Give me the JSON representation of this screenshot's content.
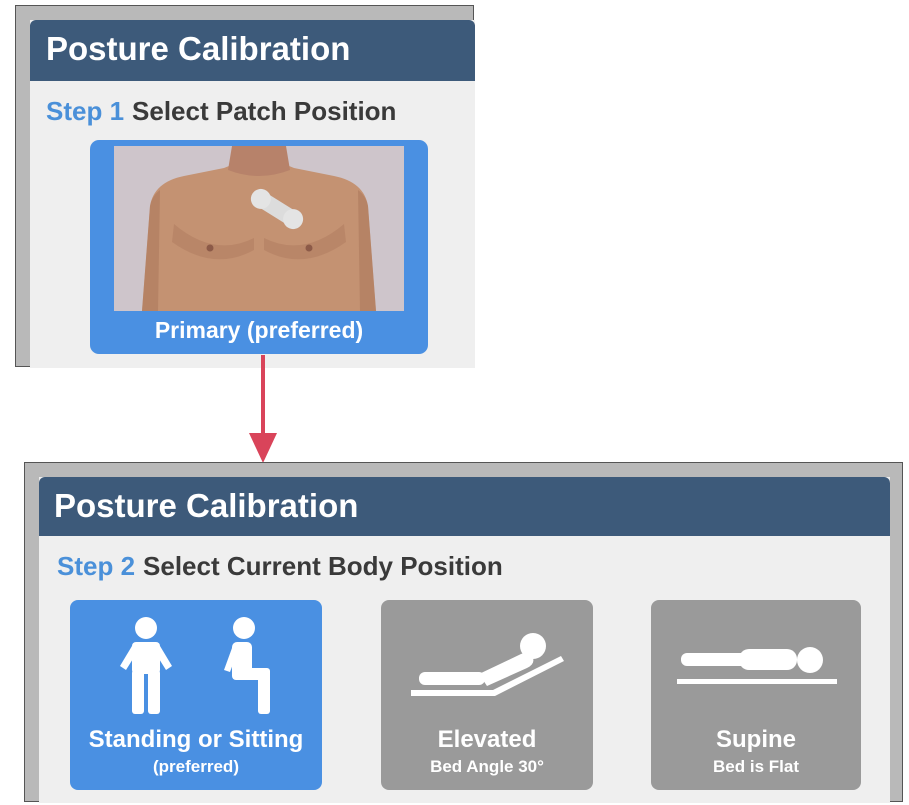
{
  "panel1": {
    "title": "Posture Calibration",
    "step_number": "Step 1",
    "step_text": "Select Patch Position",
    "patch_option": {
      "label": "Primary (preferred)",
      "selected": true
    }
  },
  "panel2": {
    "title": "Posture Calibration",
    "step_number": "Step 2",
    "step_text": "Select Current Body Position",
    "options": [
      {
        "title": "Standing or Sitting",
        "subtitle": "(preferred)",
        "selected": true,
        "icon": "standing-sitting-icon"
      },
      {
        "title": "Elevated",
        "subtitle": "Bed Angle 30°",
        "selected": false,
        "icon": "elevated-bed-icon"
      },
      {
        "title": "Supine",
        "subtitle": "Bed is Flat",
        "selected": false,
        "icon": "supine-icon"
      }
    ]
  },
  "colors": {
    "header": "#3d5a7a",
    "accent_blue": "#4a90e2",
    "step_blue": "#4a90d9",
    "unselected_gray": "#9a9a9a",
    "arrow_red": "#d9445a"
  }
}
